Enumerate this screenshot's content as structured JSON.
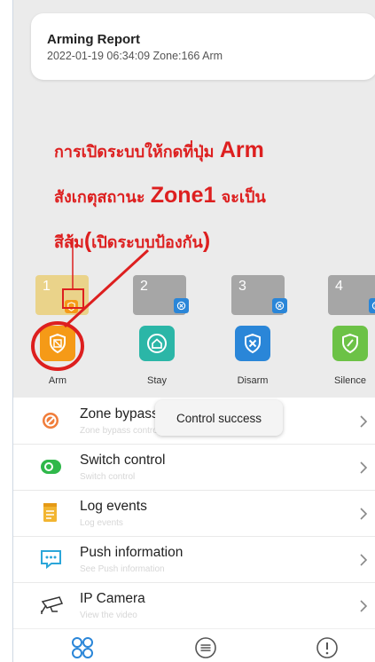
{
  "report": {
    "title": "Arming Report",
    "detail": "2022-01-19 06:34:09 Zone:166 Arm"
  },
  "annotation": {
    "line1_text": "การเปิดระบบให้กดที่ปุ่ม",
    "line1_big": "Arm",
    "line2_text": "สังเกตุสถานะ",
    "line2_big": "Zone1",
    "line2_tail": "จะเป็น",
    "line3_text": "สีส้ม",
    "line3_big": "(",
    "line3_tail": "เปิดระบบป้องกัน",
    "line3_end": ")"
  },
  "zones": [
    {
      "number": "1",
      "color": "#ead38a",
      "status": "armed"
    },
    {
      "number": "2",
      "color": "#a6a6a6",
      "status": "disarmed"
    },
    {
      "number": "3",
      "color": "#a6a6a6",
      "status": "disarmed"
    },
    {
      "number": "4",
      "color": "#a6a6a6",
      "status": "disarmed"
    }
  ],
  "controls": {
    "arm": {
      "label": "Arm",
      "color": "#f59a17",
      "icon": "shield-arm-icon"
    },
    "stay": {
      "label": "Stay",
      "color": "#2bb6a7",
      "icon": "home-shield-icon"
    },
    "disarm": {
      "label": "Disarm",
      "color": "#2a86d8",
      "icon": "shield-x-icon"
    },
    "silence": {
      "label": "Silence",
      "color": "#6cc246",
      "icon": "shield-mute-icon"
    }
  },
  "menu": {
    "zone_bypass": {
      "title": "Zone bypass",
      "subtitle": "Zone bypass control"
    },
    "switch_control": {
      "title": "Switch control",
      "subtitle": "Switch control"
    },
    "log_events": {
      "title": "Log events",
      "subtitle": "Log events"
    },
    "push_information": {
      "title": "Push information",
      "subtitle": "See Push information"
    },
    "ip_camera": {
      "title": "IP Camera",
      "subtitle": "View the video"
    }
  },
  "toast": {
    "message": "Control success"
  },
  "colors": {
    "accent_red": "#dd1f1f",
    "arm_orange": "#f59a17",
    "tab_active": "#2a86d8"
  }
}
